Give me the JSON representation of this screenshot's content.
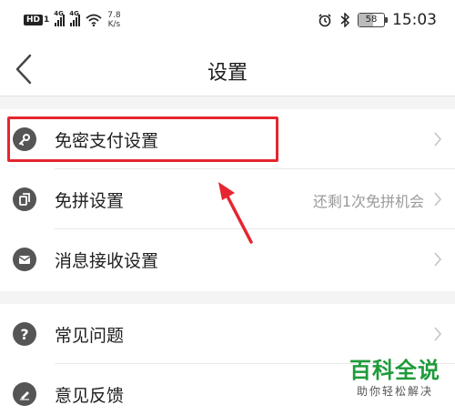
{
  "status_bar": {
    "hd_badge": "HD",
    "sim_label": "1",
    "network1": "4G",
    "network2": "4G",
    "speed_value": "7.8",
    "speed_unit": "K/s",
    "battery_level": "58",
    "time": "15:03"
  },
  "header": {
    "title": "设置"
  },
  "section1": {
    "items": [
      {
        "label": "免密支付设置",
        "value": "",
        "icon": "key-icon"
      },
      {
        "label": "免拼设置",
        "value": "还剩1次免拼机会",
        "icon": "coupon-icon"
      },
      {
        "label": "消息接收设置",
        "value": "",
        "icon": "envelope-icon"
      }
    ]
  },
  "section2": {
    "items": [
      {
        "label": "常见问题",
        "value": "",
        "icon": "question-icon"
      },
      {
        "label": "意见反馈",
        "value": "",
        "icon": "pencil-icon"
      }
    ]
  },
  "annotation": {
    "color": "#e52630"
  },
  "watermark": {
    "title": "百科全说",
    "subtitle": "助你轻松解决",
    "color": "#1f9b3a"
  }
}
